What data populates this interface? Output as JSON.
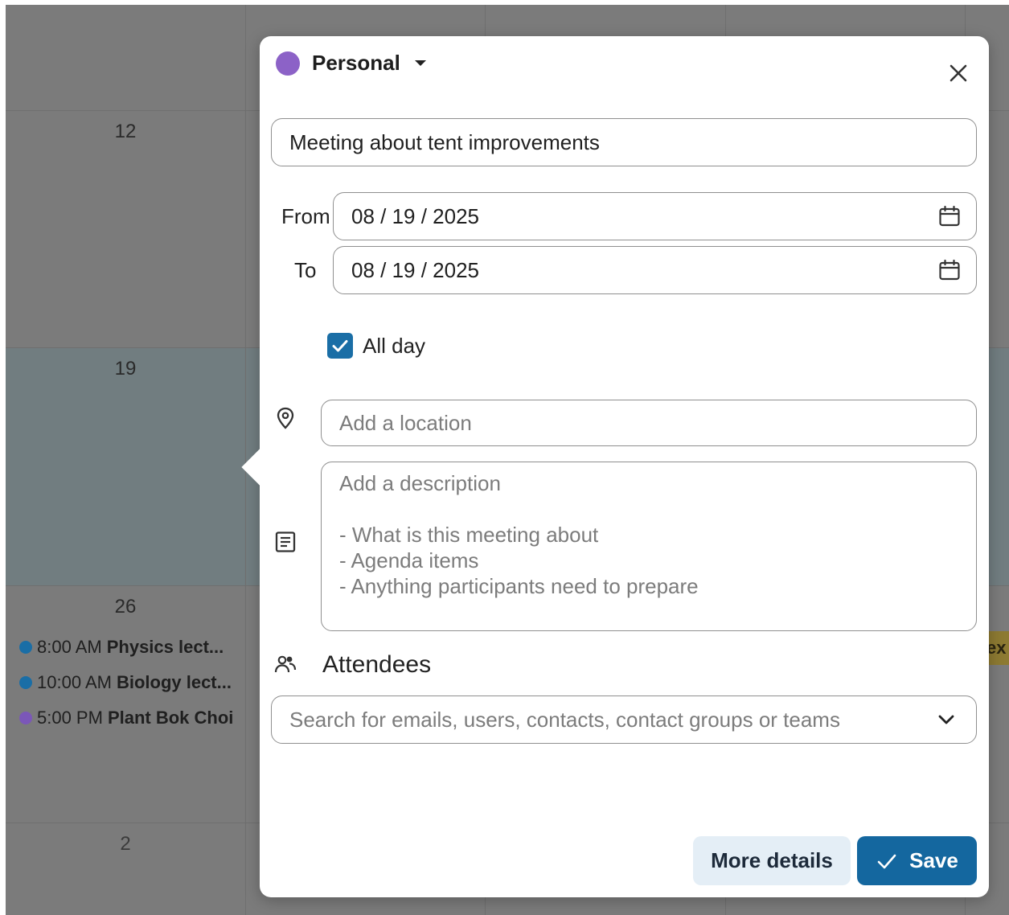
{
  "calendar": {
    "day_numbers": [
      "12",
      "19",
      "26",
      "2"
    ],
    "events": [
      {
        "time": "8:00 AM",
        "title": "Physics lect...",
        "color": "#1a6ea6"
      },
      {
        "time": "10:00 AM",
        "title": "Biology lect...",
        "color": "#1a6ea6"
      },
      {
        "time": "5:00 PM",
        "title": "Plant Bok Choi",
        "color": "#7b57b8"
      }
    ],
    "edge_chip": "ex"
  },
  "dialog": {
    "calendar_name": "Personal",
    "calendar_color": "#8c62c7",
    "title_value": "Meeting about tent improvements",
    "from_label": "From",
    "from_value": "08 / 19 / 2025",
    "to_label": "To",
    "to_value": "08 / 19 / 2025",
    "all_day_label": "All day",
    "all_day_checked": true,
    "location_placeholder": "Add a location",
    "description_placeholder": "Add a description\n\n- What is this meeting about\n- Agenda items\n- Anything participants need to prepare",
    "attendees_label": "Attendees",
    "attendees_placeholder": "Search for emails, users, contacts, contact groups or teams",
    "more_details_label": "More details",
    "save_label": "Save"
  },
  "colors": {
    "primary": "#14679f",
    "secondary_button": "#e4eef6"
  }
}
